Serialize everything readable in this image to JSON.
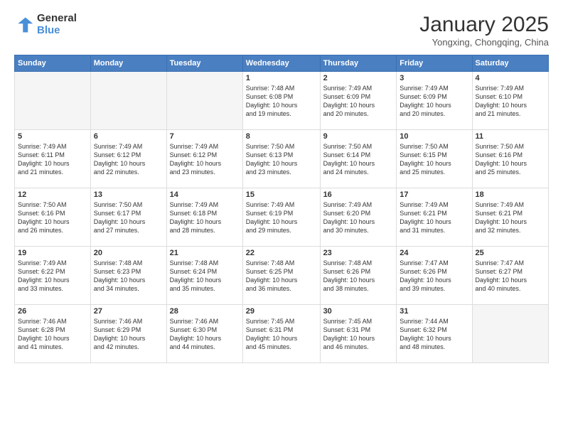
{
  "header": {
    "logo_general": "General",
    "logo_blue": "Blue",
    "month_title": "January 2025",
    "location": "Yongxing, Chongqing, China"
  },
  "days_of_week": [
    "Sunday",
    "Monday",
    "Tuesday",
    "Wednesday",
    "Thursday",
    "Friday",
    "Saturday"
  ],
  "weeks": [
    [
      {
        "day": "",
        "info": ""
      },
      {
        "day": "",
        "info": ""
      },
      {
        "day": "",
        "info": ""
      },
      {
        "day": "1",
        "info": "Sunrise: 7:48 AM\nSunset: 6:08 PM\nDaylight: 10 hours\nand 19 minutes."
      },
      {
        "day": "2",
        "info": "Sunrise: 7:49 AM\nSunset: 6:09 PM\nDaylight: 10 hours\nand 20 minutes."
      },
      {
        "day": "3",
        "info": "Sunrise: 7:49 AM\nSunset: 6:09 PM\nDaylight: 10 hours\nand 20 minutes."
      },
      {
        "day": "4",
        "info": "Sunrise: 7:49 AM\nSunset: 6:10 PM\nDaylight: 10 hours\nand 21 minutes."
      }
    ],
    [
      {
        "day": "5",
        "info": "Sunrise: 7:49 AM\nSunset: 6:11 PM\nDaylight: 10 hours\nand 21 minutes."
      },
      {
        "day": "6",
        "info": "Sunrise: 7:49 AM\nSunset: 6:12 PM\nDaylight: 10 hours\nand 22 minutes."
      },
      {
        "day": "7",
        "info": "Sunrise: 7:49 AM\nSunset: 6:12 PM\nDaylight: 10 hours\nand 23 minutes."
      },
      {
        "day": "8",
        "info": "Sunrise: 7:50 AM\nSunset: 6:13 PM\nDaylight: 10 hours\nand 23 minutes."
      },
      {
        "day": "9",
        "info": "Sunrise: 7:50 AM\nSunset: 6:14 PM\nDaylight: 10 hours\nand 24 minutes."
      },
      {
        "day": "10",
        "info": "Sunrise: 7:50 AM\nSunset: 6:15 PM\nDaylight: 10 hours\nand 25 minutes."
      },
      {
        "day": "11",
        "info": "Sunrise: 7:50 AM\nSunset: 6:16 PM\nDaylight: 10 hours\nand 25 minutes."
      }
    ],
    [
      {
        "day": "12",
        "info": "Sunrise: 7:50 AM\nSunset: 6:16 PM\nDaylight: 10 hours\nand 26 minutes."
      },
      {
        "day": "13",
        "info": "Sunrise: 7:50 AM\nSunset: 6:17 PM\nDaylight: 10 hours\nand 27 minutes."
      },
      {
        "day": "14",
        "info": "Sunrise: 7:49 AM\nSunset: 6:18 PM\nDaylight: 10 hours\nand 28 minutes."
      },
      {
        "day": "15",
        "info": "Sunrise: 7:49 AM\nSunset: 6:19 PM\nDaylight: 10 hours\nand 29 minutes."
      },
      {
        "day": "16",
        "info": "Sunrise: 7:49 AM\nSunset: 6:20 PM\nDaylight: 10 hours\nand 30 minutes."
      },
      {
        "day": "17",
        "info": "Sunrise: 7:49 AM\nSunset: 6:21 PM\nDaylight: 10 hours\nand 31 minutes."
      },
      {
        "day": "18",
        "info": "Sunrise: 7:49 AM\nSunset: 6:21 PM\nDaylight: 10 hours\nand 32 minutes."
      }
    ],
    [
      {
        "day": "19",
        "info": "Sunrise: 7:49 AM\nSunset: 6:22 PM\nDaylight: 10 hours\nand 33 minutes."
      },
      {
        "day": "20",
        "info": "Sunrise: 7:48 AM\nSunset: 6:23 PM\nDaylight: 10 hours\nand 34 minutes."
      },
      {
        "day": "21",
        "info": "Sunrise: 7:48 AM\nSunset: 6:24 PM\nDaylight: 10 hours\nand 35 minutes."
      },
      {
        "day": "22",
        "info": "Sunrise: 7:48 AM\nSunset: 6:25 PM\nDaylight: 10 hours\nand 36 minutes."
      },
      {
        "day": "23",
        "info": "Sunrise: 7:48 AM\nSunset: 6:26 PM\nDaylight: 10 hours\nand 38 minutes."
      },
      {
        "day": "24",
        "info": "Sunrise: 7:47 AM\nSunset: 6:26 PM\nDaylight: 10 hours\nand 39 minutes."
      },
      {
        "day": "25",
        "info": "Sunrise: 7:47 AM\nSunset: 6:27 PM\nDaylight: 10 hours\nand 40 minutes."
      }
    ],
    [
      {
        "day": "26",
        "info": "Sunrise: 7:46 AM\nSunset: 6:28 PM\nDaylight: 10 hours\nand 41 minutes."
      },
      {
        "day": "27",
        "info": "Sunrise: 7:46 AM\nSunset: 6:29 PM\nDaylight: 10 hours\nand 42 minutes."
      },
      {
        "day": "28",
        "info": "Sunrise: 7:46 AM\nSunset: 6:30 PM\nDaylight: 10 hours\nand 44 minutes."
      },
      {
        "day": "29",
        "info": "Sunrise: 7:45 AM\nSunset: 6:31 PM\nDaylight: 10 hours\nand 45 minutes."
      },
      {
        "day": "30",
        "info": "Sunrise: 7:45 AM\nSunset: 6:31 PM\nDaylight: 10 hours\nand 46 minutes."
      },
      {
        "day": "31",
        "info": "Sunrise: 7:44 AM\nSunset: 6:32 PM\nDaylight: 10 hours\nand 48 minutes."
      },
      {
        "day": "",
        "info": ""
      }
    ]
  ]
}
